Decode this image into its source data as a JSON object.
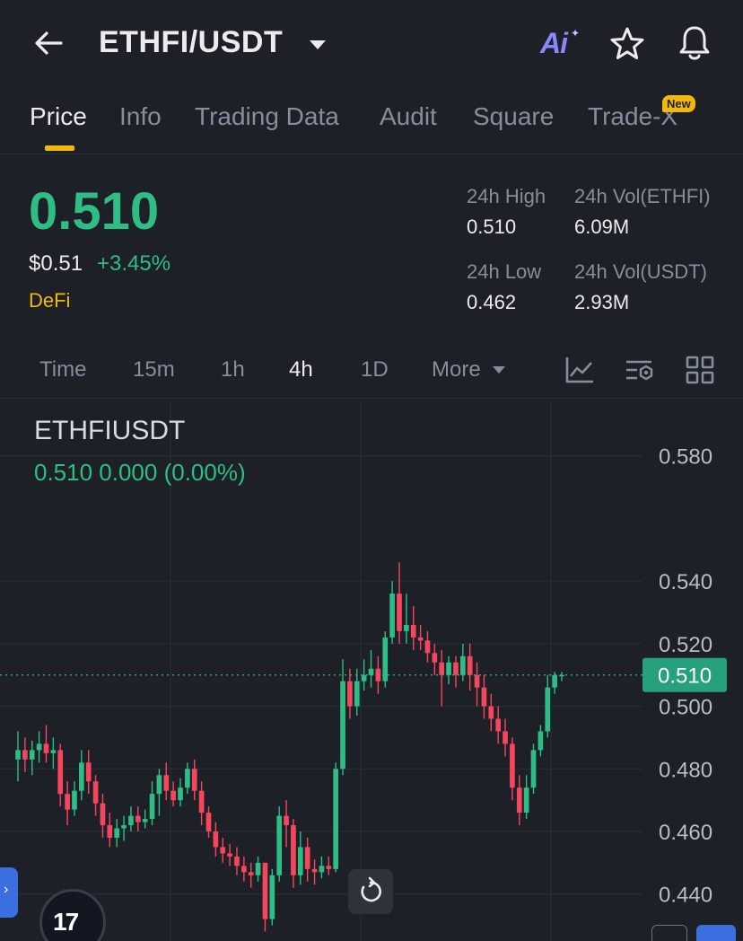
{
  "header": {
    "pair": "ETHFI/USDT",
    "ai_label": "Ai",
    "icons": [
      "back-arrow-icon",
      "dropdown-caret-icon",
      "ai-icon",
      "star-icon",
      "bell-icon"
    ]
  },
  "tabs": [
    {
      "label": "Price",
      "active": true
    },
    {
      "label": "Info"
    },
    {
      "label": "Trading Data"
    },
    {
      "label": "Audit"
    },
    {
      "label": "Square"
    },
    {
      "label": "Trade-X",
      "badge": "New"
    }
  ],
  "ticker": {
    "last_price": "0.510",
    "usd_price": "$0.51",
    "change_pct": "+3.45%",
    "tag": "DeFi",
    "high_label": "24h High",
    "high_value": "0.510",
    "vol_base_label": "24h Vol(ETHFI)",
    "vol_base_value": "6.09M",
    "low_label": "24h Low",
    "low_value": "0.462",
    "vol_quote_label": "24h Vol(USDT)",
    "vol_quote_value": "2.93M"
  },
  "intervals": [
    {
      "label": "Time"
    },
    {
      "label": "15m"
    },
    {
      "label": "1h"
    },
    {
      "label": "4h",
      "active": true
    },
    {
      "label": "1D"
    },
    {
      "label": "More"
    }
  ],
  "chart": {
    "symbol": "ETHFIUSDT",
    "ohlc_line": "0.510  0.000 (0.00%)",
    "current_price_label": "0.510"
  },
  "colors": {
    "up": "#2ebd85",
    "down": "#f6465d",
    "accent": "#f0b90b",
    "background": "#1e2028"
  },
  "chart_data": {
    "type": "candlestick",
    "yticks": [
      "0.580",
      "0.540",
      "0.520",
      "0.500",
      "0.480",
      "0.460",
      "0.440"
    ],
    "ylim": [
      0.425,
      0.598
    ],
    "last": 0.51,
    "candles": [
      [
        0.483,
        0.486,
        0.492,
        0.476
      ],
      [
        0.486,
        0.483,
        0.49,
        0.479
      ],
      [
        0.483,
        0.486,
        0.489,
        0.478
      ],
      [
        0.486,
        0.488,
        0.492,
        0.482
      ],
      [
        0.488,
        0.485,
        0.494,
        0.482
      ],
      [
        0.485,
        0.486,
        0.49,
        0.48
      ],
      [
        0.486,
        0.472,
        0.488,
        0.468
      ],
      [
        0.472,
        0.467,
        0.476,
        0.462
      ],
      [
        0.467,
        0.473,
        0.476,
        0.465
      ],
      [
        0.473,
        0.482,
        0.486,
        0.47
      ],
      [
        0.482,
        0.476,
        0.486,
        0.472
      ],
      [
        0.476,
        0.469,
        0.478,
        0.465
      ],
      [
        0.469,
        0.462,
        0.472,
        0.458
      ],
      [
        0.462,
        0.458,
        0.466,
        0.455
      ],
      [
        0.458,
        0.461,
        0.464,
        0.455
      ],
      [
        0.461,
        0.462,
        0.465,
        0.457
      ],
      [
        0.462,
        0.465,
        0.468,
        0.46
      ],
      [
        0.465,
        0.463,
        0.468,
        0.46
      ],
      [
        0.463,
        0.464,
        0.467,
        0.461
      ],
      [
        0.464,
        0.472,
        0.476,
        0.462
      ],
      [
        0.472,
        0.478,
        0.48,
        0.465
      ],
      [
        0.478,
        0.473,
        0.482,
        0.47
      ],
      [
        0.473,
        0.47,
        0.476,
        0.468
      ],
      [
        0.47,
        0.474,
        0.477,
        0.468
      ],
      [
        0.474,
        0.48,
        0.482,
        0.472
      ],
      [
        0.48,
        0.473,
        0.483,
        0.47
      ],
      [
        0.473,
        0.466,
        0.476,
        0.462
      ],
      [
        0.466,
        0.46,
        0.468,
        0.458
      ],
      [
        0.46,
        0.455,
        0.463,
        0.452
      ],
      [
        0.455,
        0.453,
        0.458,
        0.45
      ],
      [
        0.453,
        0.452,
        0.456,
        0.449
      ],
      [
        0.452,
        0.449,
        0.455,
        0.446
      ],
      [
        0.449,
        0.447,
        0.452,
        0.444
      ],
      [
        0.447,
        0.446,
        0.45,
        0.442
      ],
      [
        0.446,
        0.45,
        0.452,
        0.444
      ],
      [
        0.45,
        0.432,
        0.45,
        0.428
      ],
      [
        0.432,
        0.446,
        0.448,
        0.43
      ],
      [
        0.446,
        0.465,
        0.468,
        0.444
      ],
      [
        0.465,
        0.462,
        0.47,
        0.455
      ],
      [
        0.462,
        0.446,
        0.464,
        0.442
      ],
      [
        0.446,
        0.455,
        0.46,
        0.443
      ],
      [
        0.455,
        0.448,
        0.458,
        0.444
      ],
      [
        0.448,
        0.447,
        0.451,
        0.443
      ],
      [
        0.447,
        0.449,
        0.452,
        0.445
      ],
      [
        0.449,
        0.448,
        0.452,
        0.446
      ],
      [
        0.448,
        0.48,
        0.482,
        0.447
      ],
      [
        0.48,
        0.508,
        0.515,
        0.478
      ],
      [
        0.508,
        0.5,
        0.512,
        0.496
      ],
      [
        0.5,
        0.508,
        0.512,
        0.497
      ],
      [
        0.508,
        0.51,
        0.515,
        0.505
      ],
      [
        0.51,
        0.512,
        0.518,
        0.506
      ],
      [
        0.512,
        0.508,
        0.516,
        0.504
      ],
      [
        0.508,
        0.522,
        0.524,
        0.506
      ],
      [
        0.522,
        0.536,
        0.54,
        0.52
      ],
      [
        0.536,
        0.524,
        0.546,
        0.52
      ],
      [
        0.524,
        0.526,
        0.536,
        0.52
      ],
      [
        0.526,
        0.522,
        0.532,
        0.518
      ],
      [
        0.522,
        0.521,
        0.526,
        0.518
      ],
      [
        0.521,
        0.517,
        0.524,
        0.514
      ],
      [
        0.517,
        0.514,
        0.52,
        0.51
      ],
      [
        0.514,
        0.51,
        0.518,
        0.5
      ],
      [
        0.51,
        0.514,
        0.516,
        0.507
      ],
      [
        0.514,
        0.51,
        0.516,
        0.506
      ],
      [
        0.51,
        0.516,
        0.52,
        0.508
      ],
      [
        0.516,
        0.51,
        0.52,
        0.505
      ],
      [
        0.51,
        0.506,
        0.514,
        0.5
      ],
      [
        0.506,
        0.5,
        0.51,
        0.496
      ],
      [
        0.5,
        0.496,
        0.504,
        0.492
      ],
      [
        0.496,
        0.492,
        0.5,
        0.488
      ],
      [
        0.492,
        0.488,
        0.496,
        0.484
      ],
      [
        0.488,
        0.474,
        0.49,
        0.47
      ],
      [
        0.474,
        0.466,
        0.478,
        0.462
      ],
      [
        0.466,
        0.474,
        0.478,
        0.464
      ],
      [
        0.474,
        0.486,
        0.488,
        0.472
      ],
      [
        0.486,
        0.492,
        0.494,
        0.484
      ],
      [
        0.492,
        0.506,
        0.51,
        0.49
      ],
      [
        0.506,
        0.51,
        0.511,
        0.504
      ],
      [
        0.51,
        0.51,
        0.511,
        0.508
      ]
    ]
  }
}
